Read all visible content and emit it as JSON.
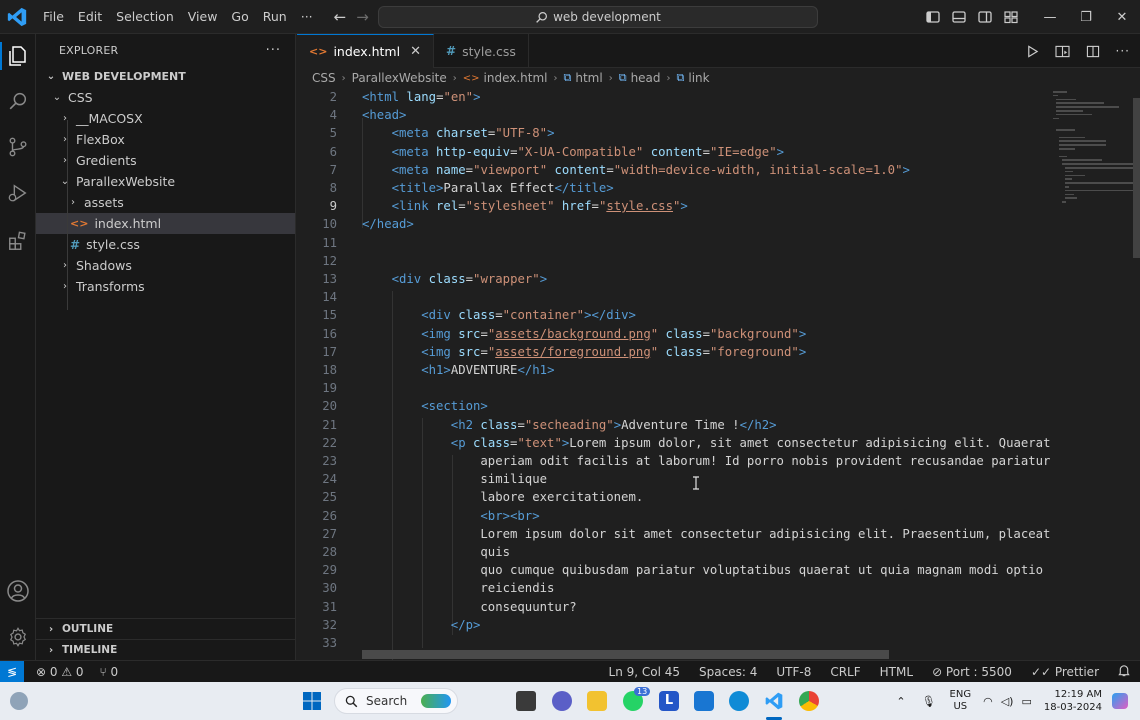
{
  "titlebar": {
    "menu": [
      "File",
      "Edit",
      "Selection",
      "View",
      "Go",
      "Run",
      "···"
    ],
    "search_text": "web development",
    "minimize": "—",
    "restore": "❐",
    "close": "✕"
  },
  "explorer": {
    "header": "EXPLORER",
    "more": "···",
    "root": "WEB DEVELOPMENT",
    "items": [
      {
        "label": "CSS",
        "chev": "⌄",
        "indent": 0
      },
      {
        "label": "__MACOSX",
        "chev": "›",
        "indent": 1
      },
      {
        "label": "FlexBox",
        "chev": "›",
        "indent": 1
      },
      {
        "label": "Gredients",
        "chev": "›",
        "indent": 1
      },
      {
        "label": "ParallexWebsite",
        "chev": "⌄",
        "indent": 1
      },
      {
        "label": "assets",
        "chev": "›",
        "indent": 2
      },
      {
        "label": "index.html",
        "icon": "<>",
        "indent": 2,
        "selected": true
      },
      {
        "label": "style.css",
        "icon": "#",
        "indent": 2
      },
      {
        "label": "Shadows",
        "chev": "›",
        "indent": 1
      },
      {
        "label": "Transforms",
        "chev": "›",
        "indent": 1
      }
    ],
    "outline": "OUTLINE",
    "timeline": "TIMELINE"
  },
  "tabs": [
    {
      "label": "index.html",
      "icon": "<>",
      "active": true,
      "close": "✕"
    },
    {
      "label": "style.css",
      "icon": "#",
      "active": false
    }
  ],
  "breadcrumb": {
    "parts": [
      "CSS",
      "ParallexWebsite",
      "index.html",
      "html",
      "head",
      "link"
    ]
  },
  "editor": {
    "current_line": 9,
    "lines": [
      {
        "n": 2,
        "i": 0,
        "t": [
          [
            "tag",
            "<html"
          ],
          [
            "attr",
            " lang"
          ],
          [
            "text",
            "="
          ],
          [
            "str",
            "\"en\""
          ],
          [
            "tag",
            ">"
          ]
        ]
      },
      {
        "n": 4,
        "i": 0,
        "t": [
          [
            "tag",
            "<head>"
          ]
        ]
      },
      {
        "n": 5,
        "i": 1,
        "t": [
          [
            "tag",
            "<meta"
          ],
          [
            "attr",
            " charset"
          ],
          [
            "text",
            "="
          ],
          [
            "str",
            "\"UTF-8\""
          ],
          [
            "tag",
            ">"
          ]
        ]
      },
      {
        "n": 6,
        "i": 1,
        "t": [
          [
            "tag",
            "<meta"
          ],
          [
            "attr",
            " http-equiv"
          ],
          [
            "text",
            "="
          ],
          [
            "str",
            "\"X-UA-Compatible\""
          ],
          [
            "attr",
            " content"
          ],
          [
            "text",
            "="
          ],
          [
            "str",
            "\"IE=edge\""
          ],
          [
            "tag",
            ">"
          ]
        ]
      },
      {
        "n": 7,
        "i": 1,
        "t": [
          [
            "tag",
            "<meta"
          ],
          [
            "attr",
            " name"
          ],
          [
            "text",
            "="
          ],
          [
            "str",
            "\"viewport\""
          ],
          [
            "attr",
            " content"
          ],
          [
            "text",
            "="
          ],
          [
            "str",
            "\"width=device-width, initial-scale=1.0\""
          ],
          [
            "tag",
            ">"
          ]
        ]
      },
      {
        "n": 8,
        "i": 1,
        "t": [
          [
            "tag",
            "<title>"
          ],
          [
            "text",
            "Parallax Effect"
          ],
          [
            "tag",
            "</title>"
          ]
        ]
      },
      {
        "n": 9,
        "i": 1,
        "t": [
          [
            "tag",
            "<link"
          ],
          [
            "attr",
            " rel"
          ],
          [
            "text",
            "="
          ],
          [
            "str",
            "\"stylesheet\""
          ],
          [
            "attr",
            " href"
          ],
          [
            "text",
            "="
          ],
          [
            "str",
            "\""
          ],
          [
            "link",
            "style.css"
          ],
          [
            "str",
            "\""
          ],
          [
            "tag",
            ">"
          ]
        ]
      },
      {
        "n": 10,
        "i": 0,
        "t": [
          [
            "tag",
            "</head>"
          ]
        ]
      },
      {
        "n": 11,
        "i": 0,
        "t": []
      },
      {
        "n": 12,
        "i": 0,
        "t": []
      },
      {
        "n": 13,
        "i": 1,
        "t": [
          [
            "tag",
            "<div"
          ],
          [
            "attr",
            " class"
          ],
          [
            "text",
            "="
          ],
          [
            "str",
            "\"wrapper\""
          ],
          [
            "tag",
            ">"
          ]
        ]
      },
      {
        "n": 14,
        "i": 0,
        "t": []
      },
      {
        "n": 15,
        "i": 2,
        "t": [
          [
            "tag",
            "<div"
          ],
          [
            "attr",
            " class"
          ],
          [
            "text",
            "="
          ],
          [
            "str",
            "\"container\""
          ],
          [
            "tag",
            "></div>"
          ]
        ]
      },
      {
        "n": 16,
        "i": 2,
        "t": [
          [
            "tag",
            "<img"
          ],
          [
            "attr",
            " src"
          ],
          [
            "text",
            "="
          ],
          [
            "str",
            "\""
          ],
          [
            "link",
            "assets/background.png"
          ],
          [
            "str",
            "\""
          ],
          [
            "attr",
            " class"
          ],
          [
            "text",
            "="
          ],
          [
            "str",
            "\"background\""
          ],
          [
            "tag",
            ">"
          ]
        ]
      },
      {
        "n": 17,
        "i": 2,
        "t": [
          [
            "tag",
            "<img"
          ],
          [
            "attr",
            " src"
          ],
          [
            "text",
            "="
          ],
          [
            "str",
            "\""
          ],
          [
            "link",
            "assets/foreground.png"
          ],
          [
            "str",
            "\""
          ],
          [
            "attr",
            " class"
          ],
          [
            "text",
            "="
          ],
          [
            "str",
            "\"foreground\""
          ],
          [
            "tag",
            ">"
          ]
        ]
      },
      {
        "n": 18,
        "i": 2,
        "t": [
          [
            "tag",
            "<h1>"
          ],
          [
            "text",
            "ADVENTURE"
          ],
          [
            "tag",
            "</h1>"
          ]
        ]
      },
      {
        "n": 19,
        "i": 0,
        "t": []
      },
      {
        "n": 20,
        "i": 2,
        "t": [
          [
            "tag",
            "<section>"
          ]
        ]
      },
      {
        "n": 21,
        "i": 3,
        "t": [
          [
            "tag",
            "<h2"
          ],
          [
            "attr",
            " class"
          ],
          [
            "text",
            "="
          ],
          [
            "str",
            "\"secheading\""
          ],
          [
            "tag",
            ">"
          ],
          [
            "text",
            "Adventure Time !"
          ],
          [
            "tag",
            "</h2>"
          ]
        ]
      },
      {
        "n": 22,
        "i": 3,
        "t": [
          [
            "tag",
            "<p"
          ],
          [
            "attr",
            " class"
          ],
          [
            "text",
            "="
          ],
          [
            "str",
            "\"text\""
          ],
          [
            "tag",
            ">"
          ],
          [
            "text",
            "Lorem ipsum dolor, sit amet consectetur adipisicing elit. Quaerat"
          ]
        ]
      },
      {
        "n": 23,
        "i": 4,
        "t": [
          [
            "text",
            "aperiam odit facilis at laborum! Id porro nobis provident recusandae pariatur"
          ]
        ]
      },
      {
        "n": 24,
        "i": 4,
        "t": [
          [
            "text",
            "similique"
          ]
        ]
      },
      {
        "n": 25,
        "i": 4,
        "t": [
          [
            "text",
            "labore exercitationem."
          ]
        ]
      },
      {
        "n": 26,
        "i": 4,
        "t": [
          [
            "tag",
            "<br><br>"
          ]
        ]
      },
      {
        "n": 27,
        "i": 4,
        "t": [
          [
            "text",
            "Lorem ipsum dolor sit amet consectetur adipisicing elit. Praesentium, placeat"
          ]
        ]
      },
      {
        "n": 28,
        "i": 4,
        "t": [
          [
            "text",
            "quis"
          ]
        ]
      },
      {
        "n": 29,
        "i": 4,
        "t": [
          [
            "text",
            "quo cumque quibusdam pariatur voluptatibus quaerat ut quia magnam modi optio"
          ]
        ]
      },
      {
        "n": 30,
        "i": 4,
        "t": [
          [
            "text",
            "reiciendis"
          ]
        ]
      },
      {
        "n": 31,
        "i": 4,
        "t": [
          [
            "text",
            "consequuntur?"
          ]
        ]
      },
      {
        "n": 32,
        "i": 3,
        "t": [
          [
            "tag",
            "</p>"
          ]
        ]
      },
      {
        "n": 33,
        "i": 0,
        "t": []
      }
    ]
  },
  "statusbar": {
    "errors": "⊗ 0 ⚠ 0",
    "ports": "⑂ 0",
    "position": "Ln 9, Col 45",
    "spaces": "Spaces: 4",
    "encoding": "UTF-8",
    "eol": "CRLF",
    "language": "HTML",
    "port": "⊘ Port : 5500",
    "prettier": "✓✓ Prettier",
    "bell": "🔔"
  },
  "taskbar": {
    "search": "Search",
    "lang_top": "ENG",
    "lang_bottom": "US",
    "time": "12:19 AM",
    "date": "18-03-2024",
    "badge_teams": "13"
  },
  "colors": {
    "accent": "#0078d4",
    "tag": "#569cd6",
    "attr": "#9cdcfe",
    "str": "#ce9178"
  }
}
